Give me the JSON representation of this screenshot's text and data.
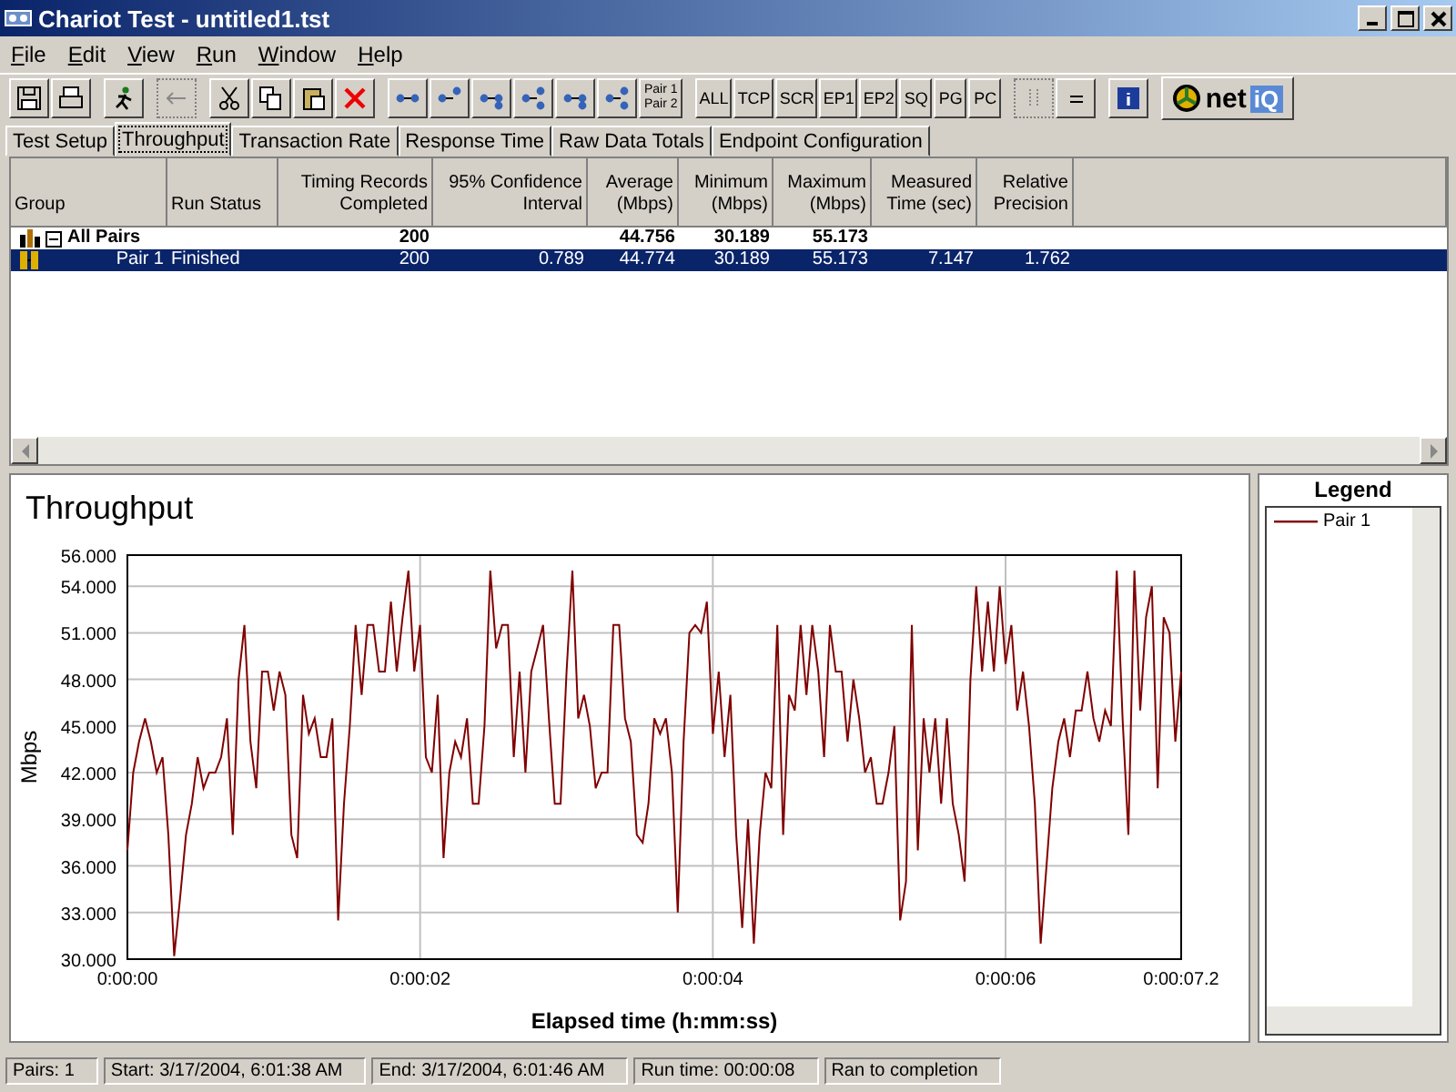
{
  "window": {
    "title": "Chariot Test - untitled1.tst"
  },
  "menu": [
    "File",
    "Edit",
    "View",
    "Run",
    "Window",
    "Help"
  ],
  "toolbar": {
    "pair_button": [
      "Pair 1",
      "Pair 2"
    ],
    "text_buttons": [
      "ALL",
      "TCP",
      "SCR",
      "EP1",
      "EP2",
      "SQ",
      "PG",
      "PC"
    ],
    "logo": [
      "net",
      "iQ"
    ]
  },
  "tabs": [
    {
      "label": "Test Setup",
      "selected": false
    },
    {
      "label": "Throughput",
      "selected": true
    },
    {
      "label": "Transaction Rate",
      "selected": false
    },
    {
      "label": "Response Time",
      "selected": false
    },
    {
      "label": "Raw Data Totals",
      "selected": false
    },
    {
      "label": "Endpoint Configuration",
      "selected": false
    }
  ],
  "table": {
    "columns": [
      "Group",
      "Run Status",
      "Timing Records Completed",
      "95% Confidence Interval",
      "Average (Mbps)",
      "Minimum (Mbps)",
      "Maximum (Mbps)",
      "Measured Time (sec)",
      "Relative Precision"
    ],
    "rows": [
      {
        "kind": "group",
        "expanded": true,
        "selected": false,
        "cells": [
          "All Pairs",
          "",
          "200",
          "",
          "44.756",
          "30.189",
          "55.173",
          "",
          ""
        ]
      },
      {
        "kind": "pair",
        "selected": true,
        "cells": [
          "Pair 1",
          "Finished",
          "200",
          "0.789",
          "44.774",
          "30.189",
          "55.173",
          "7.147",
          "1.762"
        ]
      }
    ]
  },
  "chart": {
    "chart_data": {
      "type": "line",
      "title": "Throughput",
      "xlabel": "Elapsed time (h:mm:ss)",
      "ylabel": "Mbps",
      "grid": true,
      "xlim": [
        0,
        7.2
      ],
      "ylim": [
        30,
        56
      ],
      "xticks": [
        {
          "value": 0,
          "label": "0:00:00"
        },
        {
          "value": 2,
          "label": "0:00:02"
        },
        {
          "value": 4,
          "label": "0:00:04"
        },
        {
          "value": 6,
          "label": "0:00:06"
        },
        {
          "value": 7.2,
          "label": "0:00:07.2"
        }
      ],
      "yticks": [
        {
          "value": 30,
          "label": "30.000"
        },
        {
          "value": 33,
          "label": "33.000"
        },
        {
          "value": 36,
          "label": "36.000"
        },
        {
          "value": 39,
          "label": "39.000"
        },
        {
          "value": 42,
          "label": "42.000"
        },
        {
          "value": 45,
          "label": "45.000"
        },
        {
          "value": 48,
          "label": "48.000"
        },
        {
          "value": 51,
          "label": "51.000"
        },
        {
          "value": 54,
          "label": "54.000"
        },
        {
          "value": 56,
          "label": "56.000"
        }
      ],
      "x": [
        0,
        0.04,
        0.08,
        0.12,
        0.16,
        0.2,
        0.24,
        0.28,
        0.32,
        0.36,
        0.4,
        0.44,
        0.48,
        0.52,
        0.56,
        0.6,
        0.64,
        0.68,
        0.72,
        0.76,
        0.8,
        0.84,
        0.88,
        0.92,
        0.96,
        1,
        1.04,
        1.08,
        1.12,
        1.16,
        1.2,
        1.24,
        1.28,
        1.32,
        1.36,
        1.4,
        1.44,
        1.48,
        1.52,
        1.56,
        1.6,
        1.64,
        1.68,
        1.72,
        1.76,
        1.8,
        1.84,
        1.88,
        1.92,
        1.96,
        2,
        2.04,
        2.08,
        2.12,
        2.16,
        2.2,
        2.24,
        2.28,
        2.32,
        2.36,
        2.4,
        2.44,
        2.48,
        2.52,
        2.56,
        2.6,
        2.64,
        2.68,
        2.72,
        2.76,
        2.8,
        2.84,
        2.88,
        2.92,
        2.96,
        3,
        3.04,
        3.08,
        3.12,
        3.16,
        3.2,
        3.24,
        3.28,
        3.32,
        3.36,
        3.4,
        3.44,
        3.48,
        3.52,
        3.56,
        3.6,
        3.64,
        3.68,
        3.72,
        3.76,
        3.8,
        3.84,
        3.88,
        3.92,
        3.96,
        4,
        4.04,
        4.08,
        4.12,
        4.16,
        4.2,
        4.24,
        4.28,
        4.32,
        4.36,
        4.4,
        4.44,
        4.48,
        4.52,
        4.56,
        4.6,
        4.64,
        4.68,
        4.72,
        4.76,
        4.8,
        4.84,
        4.88,
        4.92,
        4.96,
        5,
        5.04,
        5.08,
        5.12,
        5.16,
        5.2,
        5.24,
        5.28,
        5.32,
        5.36,
        5.4,
        5.44,
        5.48,
        5.52,
        5.56,
        5.6,
        5.64,
        5.68,
        5.72,
        5.76,
        5.8,
        5.84,
        5.88,
        5.92,
        5.96,
        6,
        6.04,
        6.08,
        6.12,
        6.16,
        6.2,
        6.24,
        6.28,
        6.32,
        6.36,
        6.4,
        6.44,
        6.48,
        6.52,
        6.56,
        6.6,
        6.64,
        6.68,
        6.72,
        6.76,
        6.8,
        6.84,
        6.88,
        6.92,
        6.96,
        7,
        7.04,
        7.08,
        7.12,
        7.16,
        7.2
      ],
      "series": [
        {
          "name": "Pair 1",
          "color": "#800000",
          "values": [
            37,
            42,
            44,
            45.5,
            44,
            42,
            43,
            38,
            30.2,
            34,
            38,
            40,
            43,
            41,
            42,
            42,
            43,
            45.5,
            38,
            48,
            51.5,
            44,
            41,
            48.5,
            48.5,
            46,
            48.5,
            47,
            38,
            36.5,
            47,
            44.5,
            45.5,
            43,
            43,
            45.5,
            32.5,
            40,
            45,
            51.5,
            47,
            51.5,
            51.5,
            48.5,
            48.5,
            53,
            48.5,
            52,
            55,
            48.5,
            51.5,
            43,
            42,
            47,
            36.5,
            42,
            44,
            43,
            45.5,
            40,
            40,
            45,
            55,
            50,
            51.5,
            51.5,
            43,
            48.5,
            42,
            48.5,
            50,
            51.5,
            45.5,
            40,
            40,
            48.5,
            55,
            45.5,
            47,
            45,
            41,
            42,
            42,
            51.5,
            51.5,
            45.5,
            44,
            38,
            37.5,
            40,
            45.5,
            44.5,
            45.5,
            42,
            33,
            44,
            51,
            51.5,
            51,
            53,
            44.5,
            48.5,
            43,
            47,
            38,
            32,
            39,
            31,
            38,
            42,
            41,
            51.5,
            38,
            47,
            46,
            51.5,
            47,
            51.5,
            48.5,
            43,
            51.5,
            48.5,
            48.5,
            44,
            48,
            45.5,
            42,
            43,
            40,
            40,
            42,
            45,
            32.5,
            35,
            51.5,
            37,
            45.5,
            42,
            45.5,
            40,
            45.5,
            40,
            38,
            35,
            48,
            54,
            48.5,
            53,
            48.5,
            54,
            49,
            51.5,
            46,
            48.5,
            45,
            40,
            31,
            36,
            41,
            44,
            45.5,
            43,
            46,
            46,
            48.5,
            45.5,
            44,
            46,
            45,
            55,
            45.5,
            38,
            55,
            46,
            52,
            54,
            41,
            52,
            51,
            44,
            48.5
          ]
        }
      ]
    }
  },
  "legend": {
    "title": "Legend"
  },
  "status_bar": [
    "Pairs: 1",
    "Start: 3/17/2004, 6:01:38 AM",
    "End: 3/17/2004, 6:01:46 AM",
    "Run time: 00:00:08",
    "Ran to completion"
  ]
}
